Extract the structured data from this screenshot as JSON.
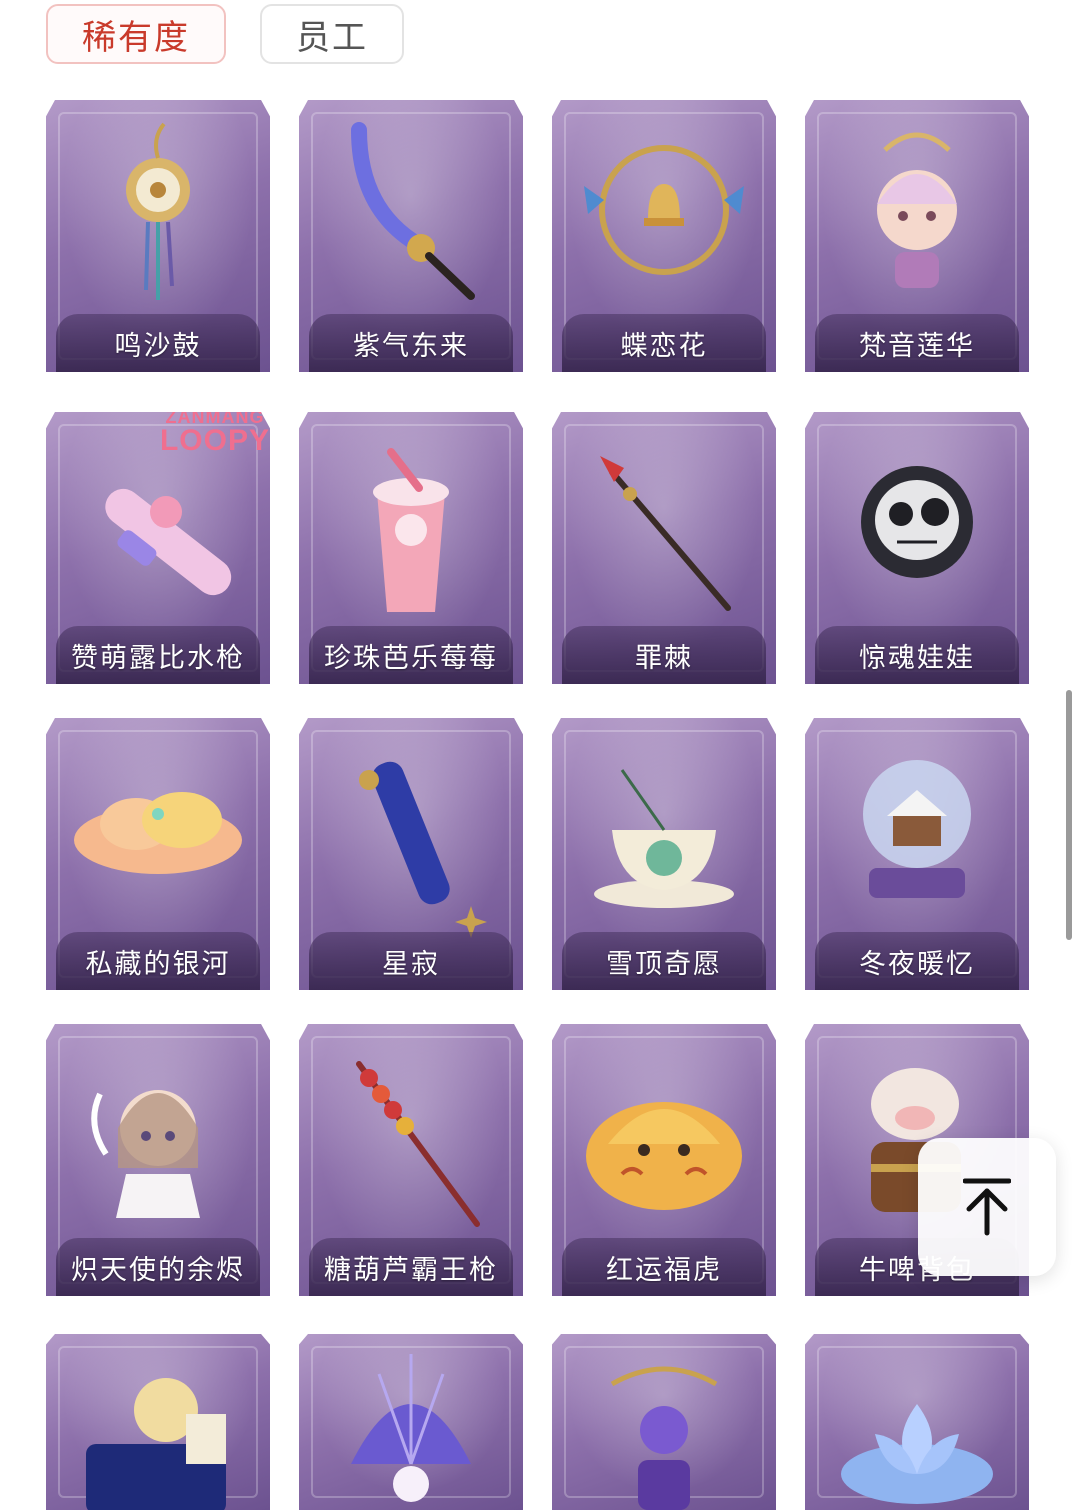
{
  "tabs": [
    {
      "label": "稀有度",
      "active": true
    },
    {
      "label": "员工",
      "active": false
    }
  ],
  "items": [
    {
      "name": "鸣沙鼓",
      "icon": "drum-charm-icon"
    },
    {
      "name": "紫气东来",
      "icon": "curved-sword-icon"
    },
    {
      "name": "蝶恋花",
      "icon": "bell-wreath-icon"
    },
    {
      "name": "梵音莲华",
      "icon": "figurine-icon"
    },
    {
      "name": "赞萌露比水枪",
      "icon": "water-gun-icon",
      "badge": {
        "line1": "ZANMANG",
        "line2": "LOOPY"
      }
    },
    {
      "name": "珍珠芭乐莓莓",
      "icon": "bubble-tea-icon"
    },
    {
      "name": "罪棘",
      "icon": "spear-icon"
    },
    {
      "name": "惊魂娃娃",
      "icon": "skull-doll-icon"
    },
    {
      "name": "私藏的银河",
      "icon": "cloud-icon"
    },
    {
      "name": "星寂",
      "icon": "scroll-staff-icon"
    },
    {
      "name": "雪顶奇愿",
      "icon": "teacup-icon"
    },
    {
      "name": "冬夜暖忆",
      "icon": "snow-globe-icon"
    },
    {
      "name": "炽天使的余烬",
      "icon": "angel-doll-icon"
    },
    {
      "name": "糖葫芦霸王枪",
      "icon": "candy-spear-icon"
    },
    {
      "name": "红运福虎",
      "icon": "tiger-plush-icon"
    },
    {
      "name": "牛啤背包",
      "icon": "cow-backpack-icon"
    },
    {
      "name": "",
      "icon": "moon-castle-icon"
    },
    {
      "name": "",
      "icon": "seashell-pearl-icon"
    },
    {
      "name": "",
      "icon": "crystal-orb-icon"
    },
    {
      "name": "",
      "icon": "blue-lotus-icon"
    }
  ],
  "back_to_top": {
    "icon": "arrow-up-to-top-icon"
  }
}
